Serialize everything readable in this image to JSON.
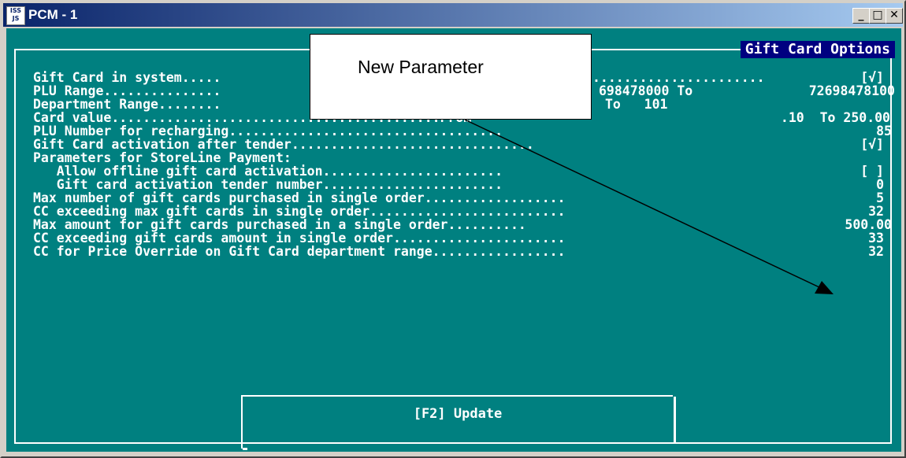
{
  "window": {
    "title": "PCM - 1",
    "icon_text": "ISS\nJS",
    "minimize_label": "_",
    "maximize_label": "□",
    "close_label": "✕"
  },
  "panel": {
    "title": "Gift Card Options",
    "lines": [
      {
        "label": "Gift Card in system.....",
        "value": "[√]"
      },
      {
        "label": "PLU Range...............",
        "from_fragment": "698478000 To",
        "value": "72698478100"
      },
      {
        "label": "Department Range........",
        "from_fragment": "To   101",
        "value": ""
      },
      {
        "label": "Card value..........................................From",
        "from_fragment": ".10  To 250.00",
        "value": ""
      },
      {
        "label": "PLU Number for recharging...................................",
        "value": "85"
      },
      {
        "label": "Gift Card activation after tender...............................",
        "value": "[√]"
      },
      {
        "label": "Parameters for StoreLine Payment:",
        "value": ""
      },
      {
        "label": "   Allow offline gift card activation.......................",
        "value": "[ ]"
      },
      {
        "label": "   Gift card activation tender number.......................",
        "value": "0"
      },
      {
        "label": "Max number of gift cards purchased in single order..................",
        "value": "5"
      },
      {
        "label": "CC exceeding max gift cards in single order.........................",
        "value": "32"
      },
      {
        "label": "Max amount for gift cards purchased in a single order..........",
        "value": "500.00"
      },
      {
        "label": "CC exceeding gift cards amount in single order......................",
        "value": "33"
      },
      {
        "label": "CC for Price Override on Gift Card department range.................",
        "value": "32"
      }
    ],
    "dots_row1": "......................",
    "dots_row2": "..........."
  },
  "callout": {
    "text": "New Parameter"
  },
  "update_button": {
    "label": "[F2] Update"
  }
}
